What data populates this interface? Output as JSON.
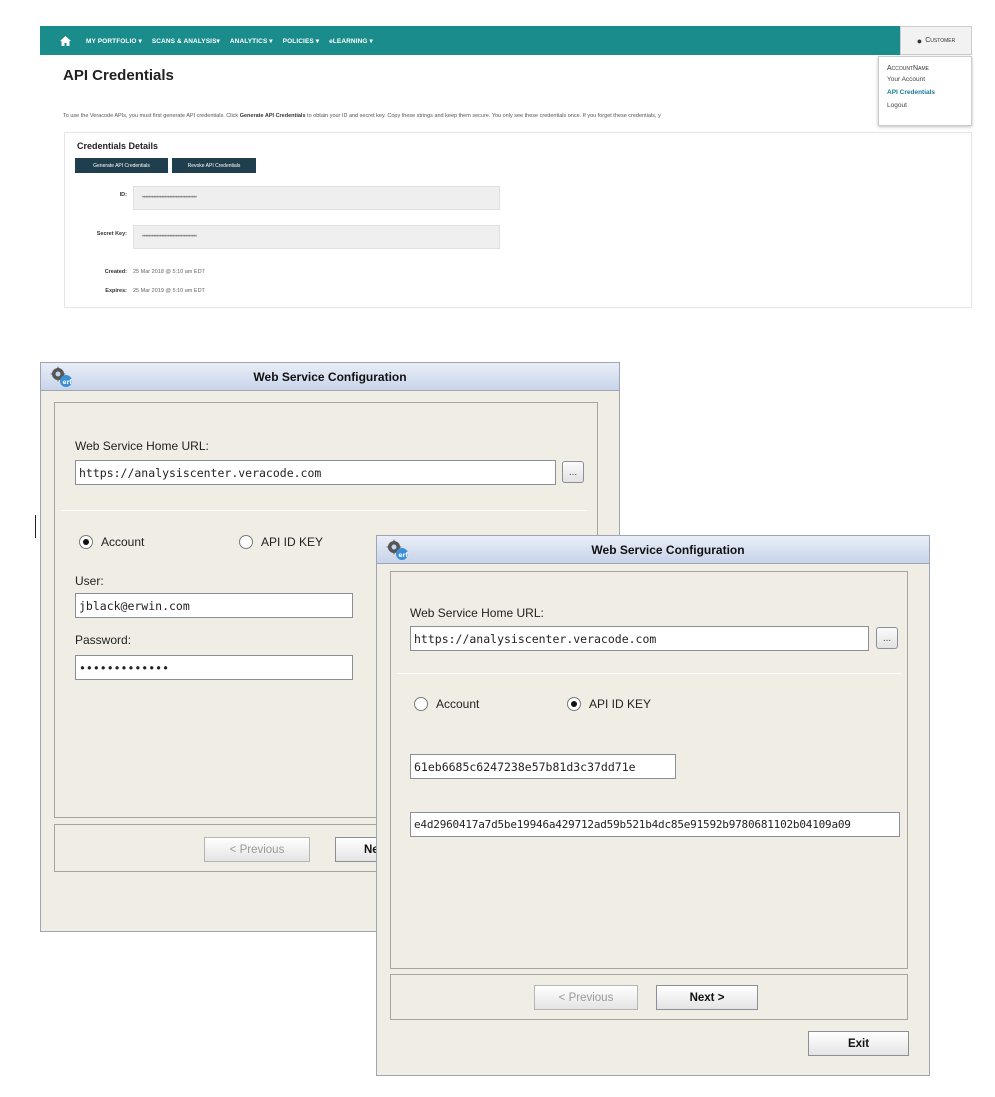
{
  "web": {
    "nav_items": [
      "MY PORTFOLIO ▾",
      "SCANS & ANALYSIS▾",
      "ANALYTICS ▾",
      "POLICIES ▾",
      "eLEARNING ▾"
    ],
    "user_label": "Customer",
    "dropdown": {
      "account_name": "AccountName",
      "items": [
        "Your Account",
        "API Credentials",
        "Logout"
      ]
    },
    "title": "API Credentials",
    "intro_prefix": "To use the Veracode APIs, you must first generate API credentials. Click ",
    "intro_bold": "Generate API Credentials",
    "intro_suffix": " to obtain your ID and secret key. Copy these strings and keep them secure. You only see these credentials once. If you forget these credentials, y",
    "credentials": {
      "heading": "Credentials Details",
      "generate_button": "Generate API Credentials",
      "revoke_button": "Revoke API Credentials",
      "id_label": "ID:",
      "id_value": "••••••••••••••••••••••••••••••••••",
      "secret_label": "Secret Key:",
      "secret_value": "••••••••••••••••••••••••••••••••••",
      "created_label": "Created:",
      "created_value": "25 Mar 2018 @ 5:10 am EDT",
      "expires_label": "Expires:",
      "expires_value": "25 Mar 2019 @ 5:10 am EDT"
    }
  },
  "dialog1": {
    "title": "Web Service Configuration",
    "url_label": "Web Service Home URL:",
    "url_value": "https://analysiscenter.veracode.com",
    "browse_label": "...",
    "radio_account": "Account",
    "radio_api": "API ID KEY",
    "account_selected": true,
    "user_label": "User:",
    "user_value": "jblack@erwin.com",
    "password_label": "Password:",
    "password_value": "•••••••••••••",
    "previous_button": "< Previous",
    "next_button_partial": "Ne"
  },
  "dialog2": {
    "title": "Web Service Configuration",
    "url_label": "Web Service Home URL:",
    "url_value": "https://analysiscenter.veracode.com",
    "browse_label": "...",
    "radio_account": "Account",
    "radio_api": "API ID KEY",
    "api_selected": true,
    "api_id_value": "61eb6685c6247238e57b81d3c37dd71e",
    "api_key_value": "e4d2960417a7d5be19946a429712ad59b521b4dc85e91592b9780681102b04109a09",
    "previous_button": "< Previous",
    "next_button": "Next >",
    "exit_button": "Exit"
  },
  "colors": {
    "navbar": "#1a8c8c",
    "dark_button": "#1f3f4f",
    "dialog_bg": "#f0ede4",
    "title_bar": "#c8d4ea"
  }
}
